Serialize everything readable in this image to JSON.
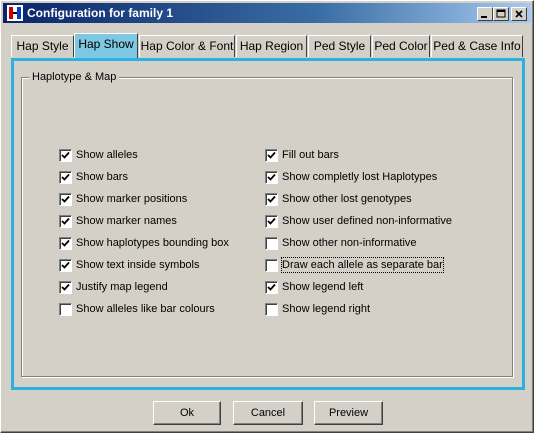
{
  "window": {
    "title": "Configuration for family 1"
  },
  "tabs": [
    {
      "label": "Hap Style",
      "active": false
    },
    {
      "label": "Hap Show",
      "active": true
    },
    {
      "label": "Hap Color & Font",
      "active": false
    },
    {
      "label": "Hap Region",
      "active": false
    },
    {
      "label": "Ped Style",
      "active": false
    },
    {
      "label": "Ped Color",
      "active": false
    },
    {
      "label": "Ped & Case Info",
      "active": false
    }
  ],
  "group": {
    "title": "Haplotype & Map"
  },
  "left_options": [
    {
      "label": "Show alleles",
      "checked": true
    },
    {
      "label": "Show bars",
      "checked": true
    },
    {
      "label": "Show marker positions",
      "checked": true
    },
    {
      "label": "Show marker names",
      "checked": true
    },
    {
      "label": "Show haplotypes bounding box",
      "checked": true
    },
    {
      "label": "Show text inside symbols",
      "checked": true
    },
    {
      "label": "Justify map legend",
      "checked": true
    },
    {
      "label": "Show alleles like bar colours",
      "checked": false
    }
  ],
  "right_options": [
    {
      "label": "Fill out bars",
      "checked": true
    },
    {
      "label": "Show completly lost Haplotypes",
      "checked": true
    },
    {
      "label": "Show other lost genotypes",
      "checked": true
    },
    {
      "label": "Show user defined non-informative",
      "checked": true
    },
    {
      "label": "Show other non-informative",
      "checked": false
    },
    {
      "label": "Draw each allele as separate bar",
      "checked": false
    },
    {
      "label": "Show legend left",
      "checked": true
    },
    {
      "label": "Show legend right",
      "checked": false
    }
  ],
  "buttons": {
    "ok": "Ok",
    "cancel": "Cancel",
    "preview": "Preview"
  },
  "colors": {
    "accent": "#2ab3e0",
    "active_tab": "#7ec8e3",
    "titlebar": "#0a246a"
  }
}
